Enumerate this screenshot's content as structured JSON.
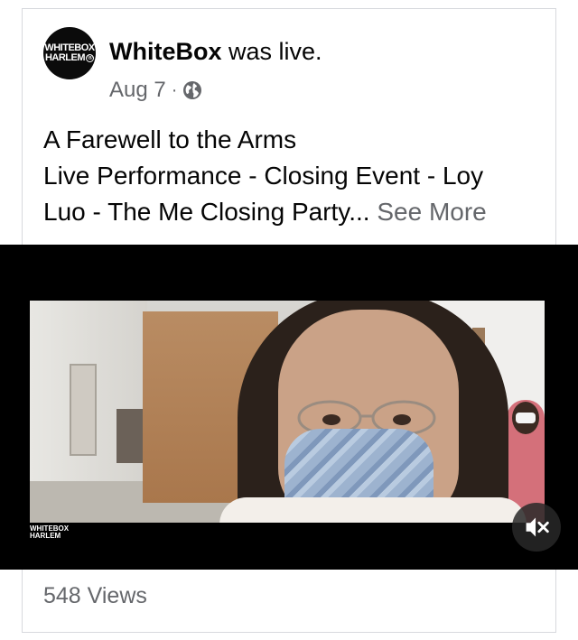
{
  "post": {
    "page_name": "WhiteBox",
    "status": "was live.",
    "date": "Aug 7",
    "separator": "·",
    "privacy_icon": "globe-icon",
    "text_lines": [
      "A Farewell to the Arms",
      "Live Performance - Closing Event - Loy",
      "Luo - The Me Closing Party..."
    ],
    "see_more": "See More"
  },
  "avatar": {
    "line1": "WHITEBOX",
    "line2": "HARLEM",
    "mark": "®"
  },
  "video": {
    "watermark_line1": "WHITEBOX",
    "watermark_line2": "HARLEM",
    "mute_icon": "speaker-muted-icon"
  },
  "footer": {
    "views": "548 Views"
  },
  "colors": {
    "primary_text": "#050505",
    "secondary_text": "#65676b",
    "border": "#d7d9dd",
    "video_background": "#000000"
  }
}
